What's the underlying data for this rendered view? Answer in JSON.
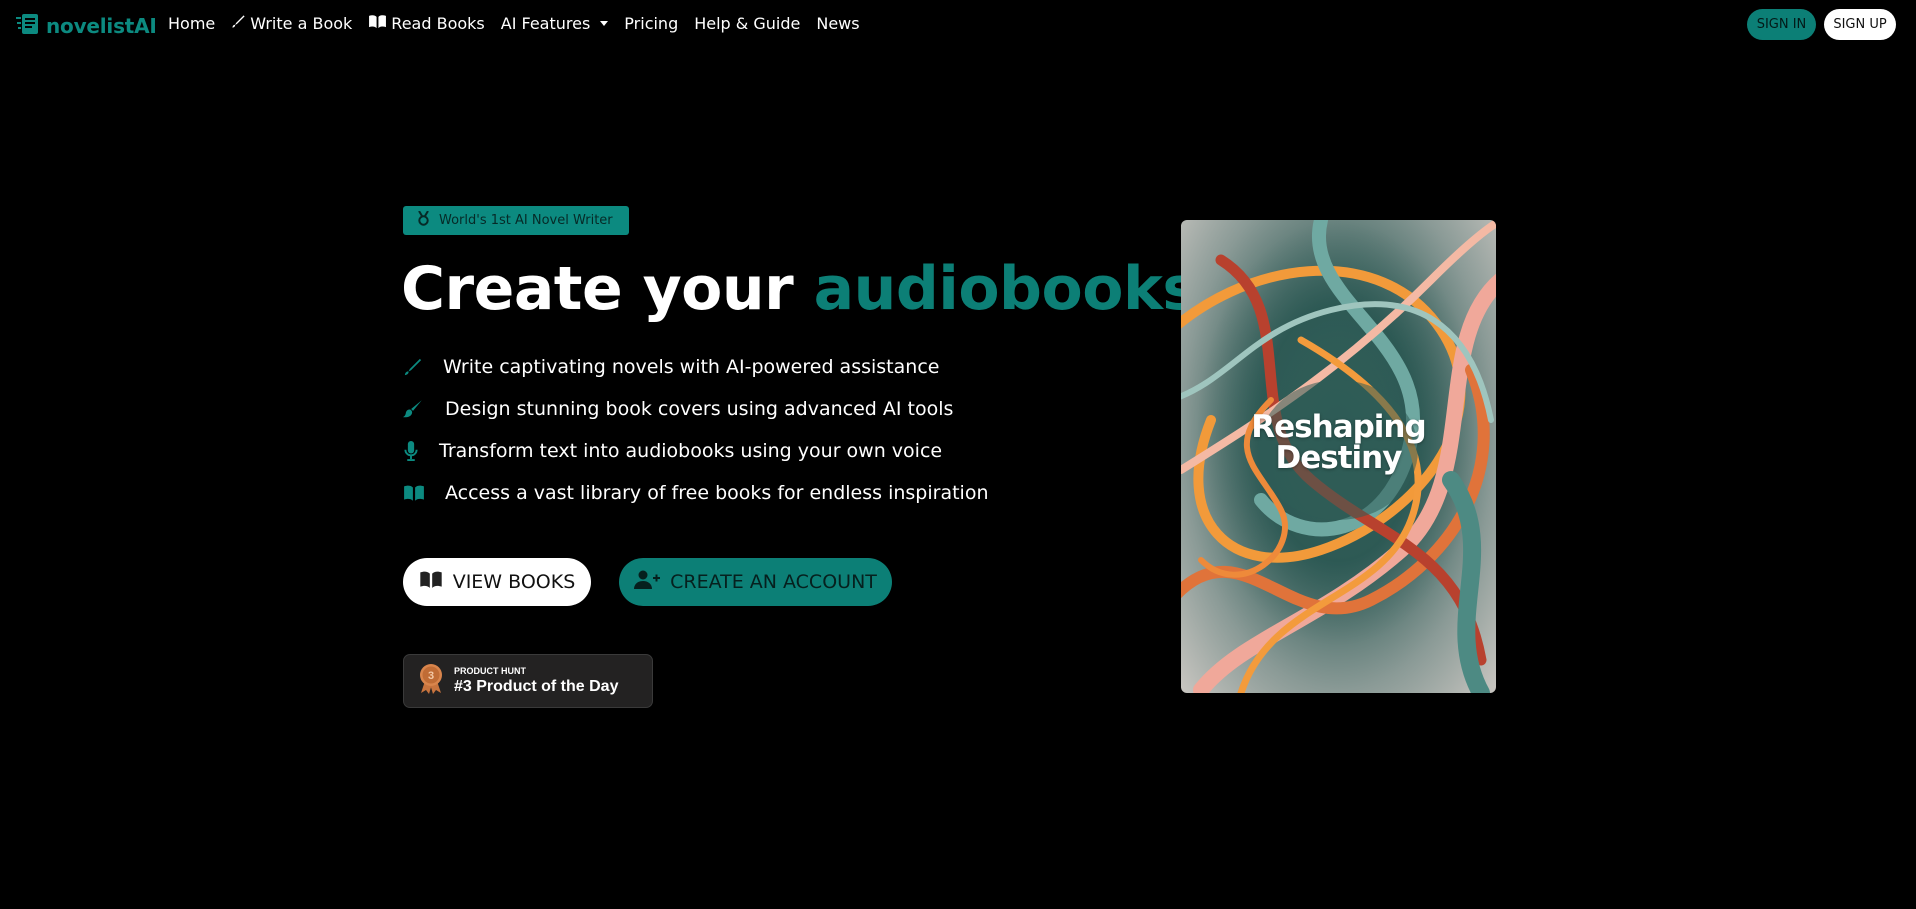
{
  "brand": {
    "name": "novelistAI",
    "icon": "novelistai-logo-icon"
  },
  "nav": {
    "home": "Home",
    "write": "Write a Book",
    "read": "Read Books",
    "ai_features": "AI Features",
    "pricing": "Pricing",
    "help": "Help & Guide",
    "news": "News",
    "sign_in": "SIGN IN",
    "sign_up": "SIGN UP"
  },
  "hero": {
    "badge": "World's 1st AI Novel Writer",
    "headline_part1": "Create your",
    "headline_accent": "audiobooks",
    "features": [
      {
        "text": "Write captivating novels with AI-powered assistance",
        "icon": "pen-icon"
      },
      {
        "text": "Design stunning book covers using advanced AI tools",
        "icon": "paintbrush-icon"
      },
      {
        "text": "Transform text into audiobooks using your own voice",
        "icon": "microphone-icon"
      },
      {
        "text": "Access a vast library of free books for endless inspiration",
        "icon": "book-open-icon"
      }
    ],
    "view_books": "VIEW BOOKS",
    "create_account": "CREATE AN ACCOUNT"
  },
  "product_hunt": {
    "label": "PRODUCT HUNT",
    "title": "#3 Product of the Day",
    "medal_number": "3"
  },
  "cover": {
    "title_line1": "Reshaping",
    "title_line2": "Destiny"
  },
  "colors": {
    "accent": "#0c7f76",
    "background": "#000000",
    "text": "#ffffff"
  }
}
